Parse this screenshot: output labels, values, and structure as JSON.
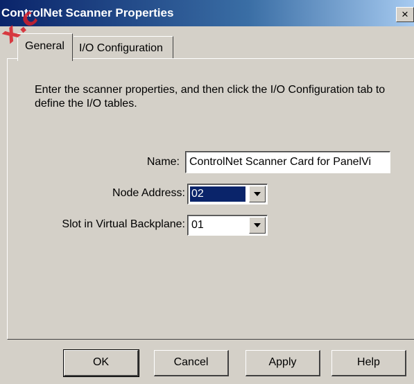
{
  "window": {
    "title": "ControlNet Scanner Properties",
    "close_glyph": "×"
  },
  "tabs": [
    {
      "label": "General",
      "active": true
    },
    {
      "label": "I/O Configuration",
      "active": false
    }
  ],
  "general": {
    "instructions": "Enter the scanner properties, and then click the I/O Configuration tab to define the I/O tables.",
    "name_label": "Name:",
    "name_value": "ControlNet Scanner Card for PanelVi",
    "node_label": "Node Address:",
    "node_value": "02",
    "slot_label": "Slot in Virtual Backplane:",
    "slot_value": "01"
  },
  "buttons": {
    "ok": "OK",
    "cancel": "Cancel",
    "apply": "Apply",
    "help": "Help"
  },
  "watermark": "x.c",
  "colors": {
    "titlebar_start": "#0a246a",
    "face": "#d4d0c8",
    "selection": "#0a246a",
    "watermark": "#d71e28"
  }
}
